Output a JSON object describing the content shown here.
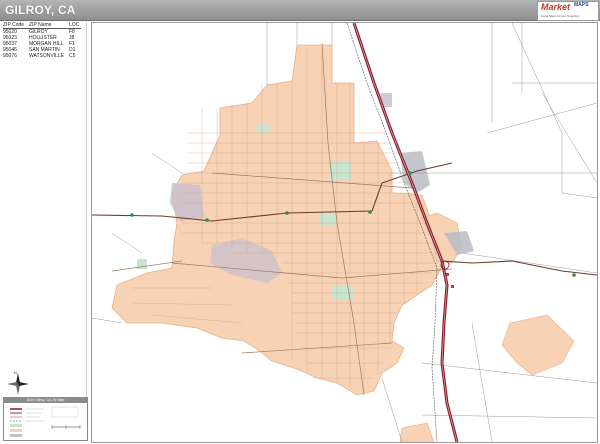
{
  "header": {
    "title": "GILROY, CA",
    "logo_main": "Market",
    "logo_sub": "MAPS",
    "logo_tagline": "Local Maps at your fingertips"
  },
  "zip_table": {
    "columns": [
      "ZIP Code",
      "ZIP Name",
      "LOC"
    ],
    "rows": [
      [
        "95020",
        "GILROY",
        "F8"
      ],
      [
        "95023",
        "HOLLISTER",
        "J8"
      ],
      [
        "95037",
        "MORGAN HILL",
        "F1"
      ],
      [
        "95046",
        "SAN MARTIN",
        "D1"
      ],
      [
        "95076",
        "WATSONVILLE",
        "C5"
      ]
    ]
  },
  "legend": {
    "title": "2019 Gilroy, CA Zip Map"
  },
  "compass": {
    "label": "N"
  },
  "colors": {
    "city_fill": "#f7d2b4",
    "city_edge": "#e7b08c",
    "highway": "#8b1a2a",
    "road": "#5a3a2a",
    "park": "#c9e4cf",
    "institution": "#c9c0cc",
    "title_bar": "#9e9e9e"
  }
}
